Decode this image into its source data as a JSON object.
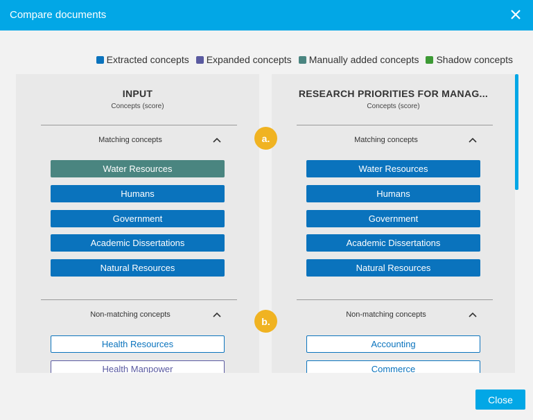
{
  "dialog": {
    "title": "Compare documents",
    "close_icon": "close-icon",
    "close_button": "Close"
  },
  "legend": [
    {
      "label": "Extracted concepts",
      "color": "#0a73bd"
    },
    {
      "label": "Expanded concepts",
      "color": "#5a5aa0"
    },
    {
      "label": "Manually added concepts",
      "color": "#4a8580"
    },
    {
      "label": "Shadow concepts",
      "color": "#3d9a35"
    }
  ],
  "left": {
    "title": "INPUT",
    "subtitle": "Concepts (score)",
    "matching_label": "Matching concepts",
    "nonmatching_label": "Non-matching concepts",
    "matching": [
      "Water Resources",
      "Humans",
      "Government",
      "Academic Dissertations",
      "Natural Resources"
    ],
    "nonmatching": [
      "Health Resources",
      "Health Manpower"
    ]
  },
  "right": {
    "title": "RESEARCH PRIORITIES FOR MANAG...",
    "subtitle": "Concepts (score)",
    "matching_label": "Matching concepts",
    "nonmatching_label": "Non-matching concepts",
    "matching": [
      "Water Resources",
      "Humans",
      "Government",
      "Academic Dissertations",
      "Natural Resources"
    ],
    "nonmatching": [
      "Accounting",
      "Commerce"
    ]
  },
  "markers": {
    "a": "a.",
    "b": "b."
  }
}
